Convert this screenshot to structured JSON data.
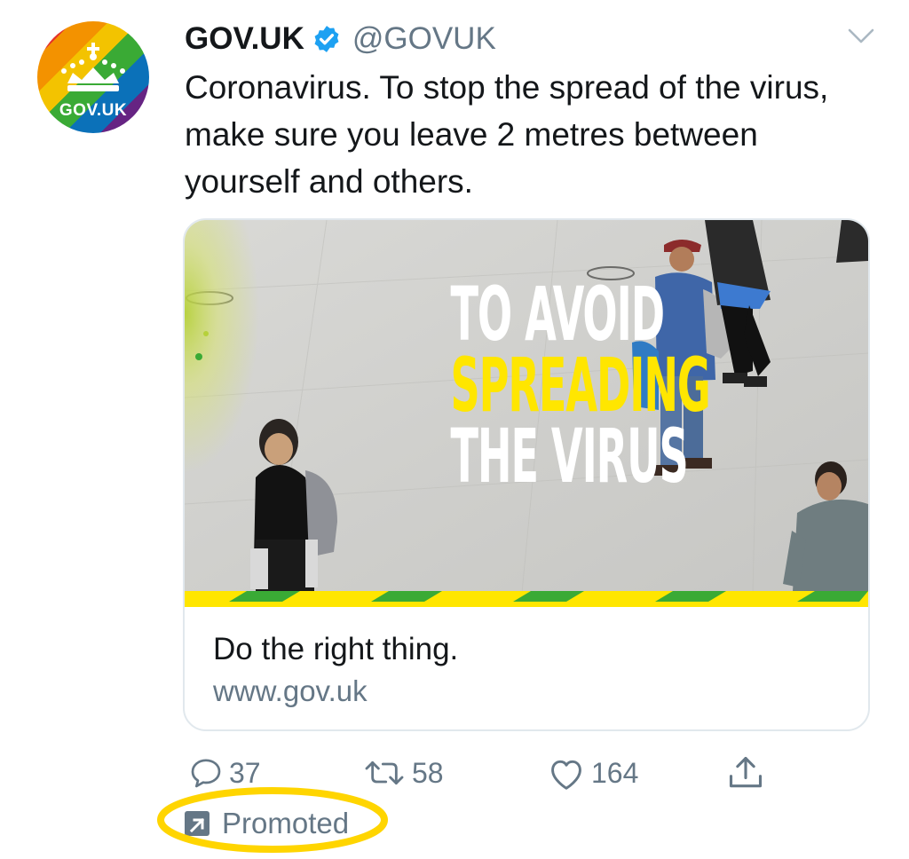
{
  "account": {
    "display_name": "GOV.UK",
    "handle": "@GOVUK",
    "avatar_label": "GOV.UK",
    "verified": true
  },
  "tweet": {
    "text": "Coronavirus. To stop the spread of the virus, make sure you leave 2 metres between yourself and others."
  },
  "card": {
    "image_headline": [
      "TO AVOID",
      "SPREADING",
      "THE VIRUS"
    ],
    "title": "Do the right thing.",
    "domain": "www.gov.uk"
  },
  "actions": {
    "reply_count": "37",
    "retweet_count": "58",
    "like_count": "164"
  },
  "promoted_label": "Promoted",
  "colors": {
    "text_primary": "#14171a",
    "text_secondary": "#657786",
    "verified_blue": "#1da1f2",
    "card_border": "#e1e8ed",
    "highlight_yellow": "#ffd500",
    "headline_yellow": "#ffe600"
  },
  "icons": [
    "verified-badge-icon",
    "chevron-down-icon",
    "reply-icon",
    "retweet-icon",
    "like-icon",
    "share-icon",
    "promoted-arrow-icon",
    "crown-icon"
  ]
}
